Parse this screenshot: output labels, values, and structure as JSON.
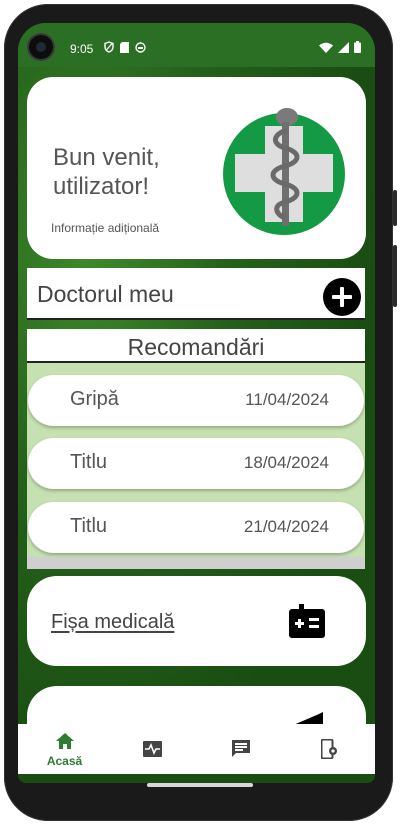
{
  "status_bar": {
    "time": "9:05"
  },
  "welcome": {
    "title": "Bun venit, utilizator!",
    "subtitle": "Informație adițională"
  },
  "doctor": {
    "label": "Doctorul meu"
  },
  "recommendations": {
    "header": "Recomandări",
    "items": [
      {
        "title": "Gripă",
        "date": "11/04/2024"
      },
      {
        "title": "Titlu",
        "date": "18/04/2024"
      },
      {
        "title": "Titlu",
        "date": "21/04/2024"
      }
    ]
  },
  "medical_record": {
    "label": "Fișa medicală"
  },
  "bottom_nav": {
    "items": [
      {
        "label": "Acasă",
        "icon": "home-icon",
        "active": true
      },
      {
        "label": "",
        "icon": "activity-icon",
        "active": false
      },
      {
        "label": "",
        "icon": "message-icon",
        "active": false
      },
      {
        "label": "",
        "icon": "device-settings-icon",
        "active": false
      }
    ],
    "active_color": "#2e7d32"
  },
  "colors": {
    "status_bar": "#2b6f25",
    "recommendation_bg": "#c6e1b1",
    "logo_green": "#149a45"
  }
}
